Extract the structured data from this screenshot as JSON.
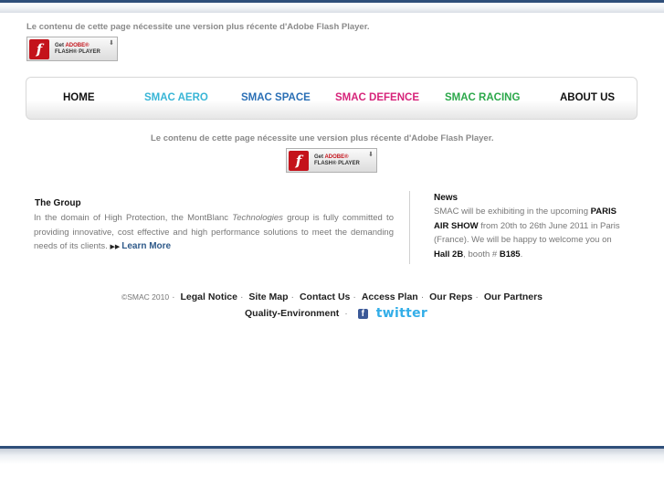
{
  "flash_notice": {
    "message": "Le contenu de cette page nécessite une version plus récente d'Adobe Flash Player.",
    "badge_get": "Get",
    "badge_adobe": "ADOBE®",
    "badge_player": "FLASH® PLAYER",
    "badge_logo": "f"
  },
  "nav": {
    "items": [
      {
        "label": "HOME",
        "color": "#111111"
      },
      {
        "label": "SMAC AERO",
        "color": "#38b5d6"
      },
      {
        "label": "SMAC SPACE",
        "color": "#2a6fb5"
      },
      {
        "label": "SMAC DEFENCE",
        "color": "#d6247a"
      },
      {
        "label": "SMAC RACING",
        "color": "#2ba84a"
      },
      {
        "label": "ABOUT US",
        "color": "#111111"
      }
    ]
  },
  "group": {
    "title": "The Group",
    "text_before": "In the domain of High Protection, the MontBlanc ",
    "text_italic": "Technologies",
    "text_after": " group is fully committed to providing innovative, cost effective and high performance solutions to meet the demanding needs of its clients. ",
    "learn_more": "Learn More"
  },
  "news": {
    "title": "News",
    "t1": "SMAC will be exhibiting in the upcoming ",
    "b1": "PARIS AIR SHOW",
    "t2": " from 20th to 26th June 2011 in Paris (France). We will be happy to welcome you on ",
    "b2": "Hall 2B",
    "t3": ", booth # ",
    "b3": "B185",
    "t4": "."
  },
  "footer": {
    "copyright": "©SMAC 2010",
    "links": [
      "Legal Notice",
      "Site Map",
      "Contact Us",
      "Access Plan",
      "Our Reps",
      "Our Partners"
    ],
    "quality": "Quality-Environment",
    "facebook_glyph": "f",
    "twitter": "twitter"
  },
  "icons": {
    "arrow": "double-arrow-icon",
    "facebook": "facebook-icon",
    "twitter": "twitter-logo-icon"
  }
}
